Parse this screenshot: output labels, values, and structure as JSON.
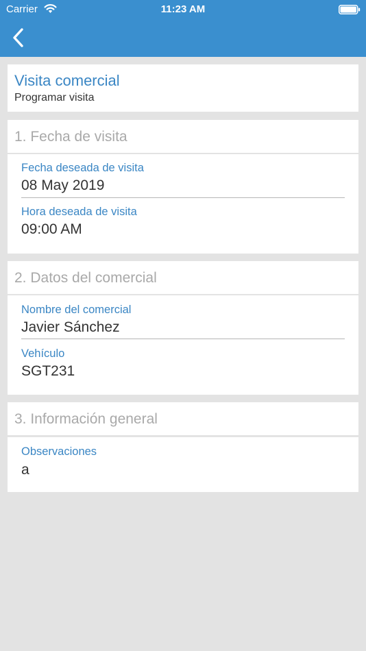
{
  "status_bar": {
    "carrier": "Carrier",
    "time": "11:23 AM"
  },
  "colors": {
    "accent": "#3a8fcf",
    "label": "#3a86c4",
    "section_title": "#a9a9a9",
    "background": "#e3e3e3"
  },
  "header": {
    "title": "Visita comercial",
    "subtitle": "Programar visita"
  },
  "sections": [
    {
      "title": "1. Fecha de visita",
      "fields": [
        {
          "label": "Fecha deseada de visita",
          "value": "08 May 2019"
        },
        {
          "label": "Hora deseada de visita",
          "value": "09:00 AM"
        }
      ]
    },
    {
      "title": "2. Datos del comercial",
      "fields": [
        {
          "label": "Nombre del comercial",
          "value": "Javier Sánchez"
        },
        {
          "label": "Vehículo",
          "value": "SGT231"
        }
      ]
    },
    {
      "title": "3. Información general",
      "fields": [
        {
          "label": "Observaciones",
          "value": "a"
        }
      ]
    }
  ]
}
